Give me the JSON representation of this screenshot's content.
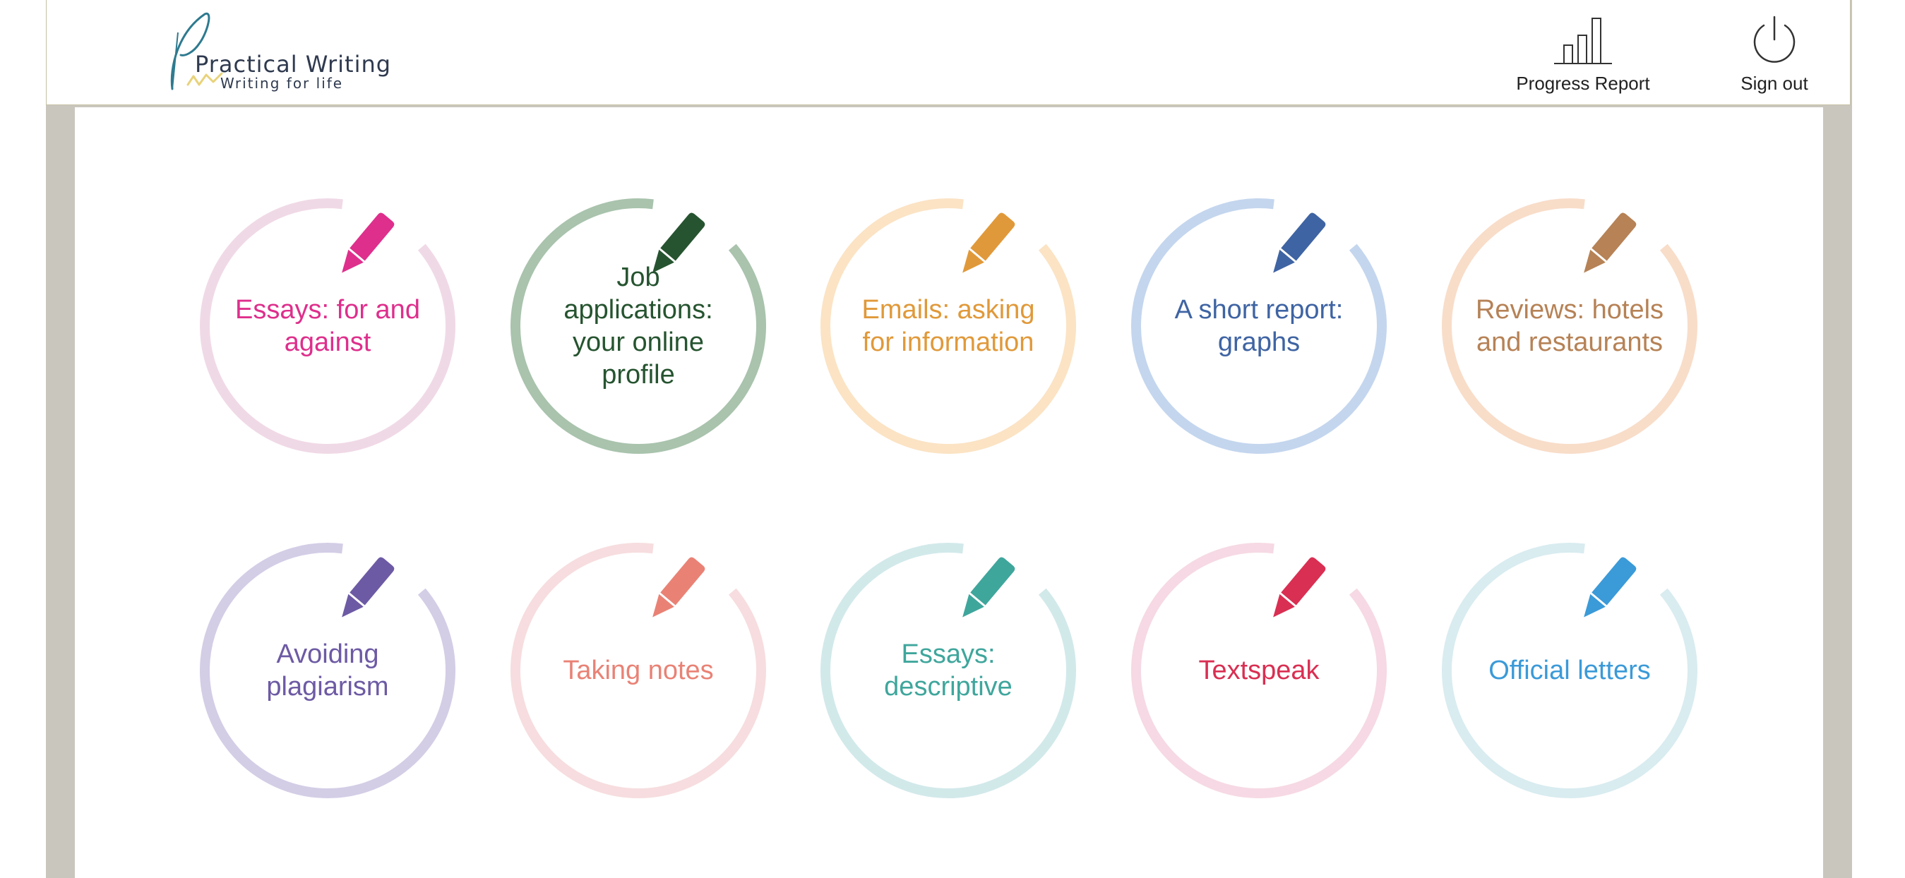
{
  "header": {
    "logo_title": "Practical Writing",
    "logo_tagline": "Writing for life",
    "progress_report_label": "Progress Report",
    "sign_out_label": "Sign out"
  },
  "topics": [
    {
      "title": "Essays: for and against",
      "color": "#de2f8c",
      "ring": "#f0d9e6"
    },
    {
      "title": "Job applications: your online profile",
      "color": "#265430",
      "ring": "#a9c3ad"
    },
    {
      "title": "Emails: asking for information",
      "color": "#e0993a",
      "ring": "#fbe3c4"
    },
    {
      "title": "A short report: graphs",
      "color": "#3f64a3",
      "ring": "#c4d6ee"
    },
    {
      "title": "Reviews: hotels and restaurants",
      "color": "#b68256",
      "ring": "#f8ddc9"
    },
    {
      "title": "Avoiding plagiarism",
      "color": "#6d5aa4",
      "ring": "#d4cde6"
    },
    {
      "title": "Taking notes",
      "color": "#e98275",
      "ring": "#f7dddf"
    },
    {
      "title": "Essays: descriptive",
      "color": "#3fa69c",
      "ring": "#d2e9ea"
    },
    {
      "title": "Textspeak",
      "color": "#d92f52",
      "ring": "#f6d9e4"
    },
    {
      "title": "Official letters",
      "color": "#3b9ad8",
      "ring": "#d9ecf0"
    }
  ]
}
